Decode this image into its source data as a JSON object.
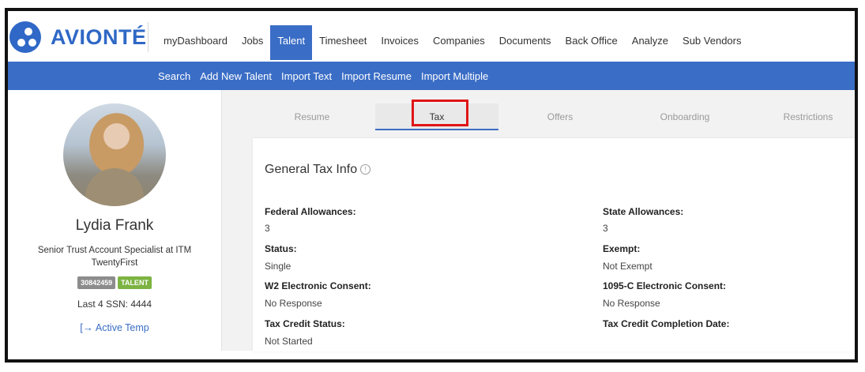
{
  "brand": {
    "name": "AVIONTÉ",
    "color": "#2f68c6"
  },
  "nav": {
    "items": [
      {
        "label": "myDashboard"
      },
      {
        "label": "Jobs"
      },
      {
        "label": "Talent",
        "active": true
      },
      {
        "label": "Timesheet"
      },
      {
        "label": "Invoices"
      },
      {
        "label": "Companies"
      },
      {
        "label": "Documents"
      },
      {
        "label": "Back Office"
      },
      {
        "label": "Analyze"
      },
      {
        "label": "Sub Vendors"
      }
    ]
  },
  "subnav": {
    "items": [
      {
        "label": "Search"
      },
      {
        "label": "Add New Talent"
      },
      {
        "label": "Import Text"
      },
      {
        "label": "Import Resume"
      },
      {
        "label": "Import Multiple"
      }
    ]
  },
  "profile": {
    "name": "Lydia Frank",
    "title": "Senior Trust Account Specialist at ITM TwentyFirst",
    "id_badge": "30842459",
    "type_badge": "TALENT",
    "ssn": "Last 4 SSN: 4444",
    "status": "Active Temp"
  },
  "tabs": [
    {
      "label": "Resume"
    },
    {
      "label": "Tax",
      "selected": true
    },
    {
      "label": "Offers"
    },
    {
      "label": "Onboarding"
    },
    {
      "label": "Restrictions"
    }
  ],
  "tax": {
    "section_title": "General Tax Info",
    "info_icon": "info-icon",
    "fields": {
      "federal_allowances": {
        "label": "Federal Allowances:",
        "value": "3"
      },
      "state_allowances": {
        "label": "State Allowances:",
        "value": "3"
      },
      "status": {
        "label": "Status:",
        "value": "Single"
      },
      "exempt": {
        "label": "Exempt:",
        "value": "Not Exempt"
      },
      "w2_consent": {
        "label": "W2 Electronic Consent:",
        "value": "No Response"
      },
      "c1095_consent": {
        "label": "1095-C Electronic Consent:",
        "value": "No Response"
      },
      "tax_credit_status": {
        "label": "Tax Credit Status:",
        "value": "Not Started"
      },
      "tax_credit_date": {
        "label": "Tax Credit Completion Date:",
        "value": ""
      }
    }
  },
  "colors": {
    "accent": "#3a6dc6",
    "highlight": "#e01515",
    "badge_id": "#8c8c8c",
    "badge_talent": "#7cb342"
  }
}
